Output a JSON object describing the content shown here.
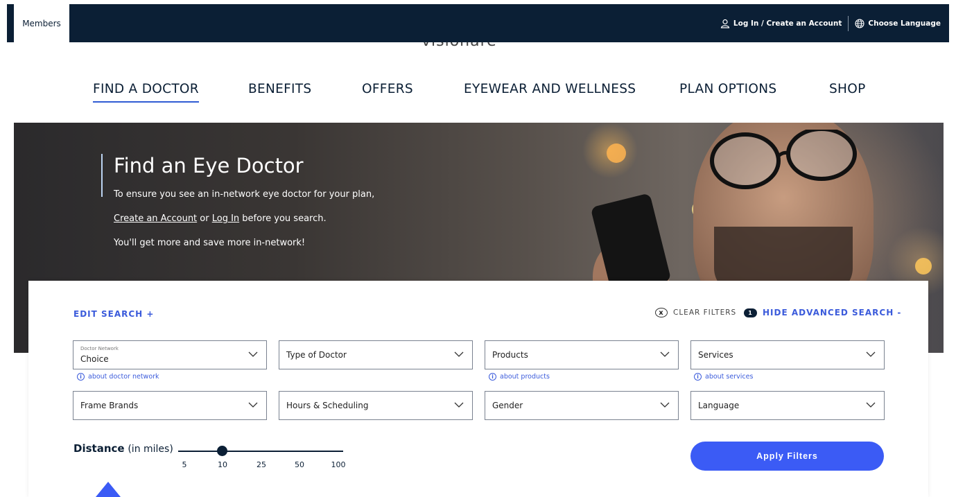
{
  "topbar": {
    "members_label": "Members",
    "login_label": "Log In / Create an Account",
    "language_label": "Choose Language",
    "logo_text": "visionare"
  },
  "nav": {
    "items": [
      "FIND A DOCTOR",
      "BENEFITS",
      "OFFERS",
      "EYEWEAR AND WELLNESS",
      "PLAN OPTIONS",
      "SHOP"
    ],
    "active": "FIND A DOCTOR"
  },
  "hero": {
    "title": "Find an Eye Doctor",
    "line1": "To ensure you see an in-network eye doctor for your plan,",
    "create_link": "Create an Account",
    "or_text": " or ",
    "login_link": "Log In",
    "line2_suffix": " before you search.",
    "line3": "You'll get more and save more in-network!"
  },
  "search": {
    "edit_label": "EDIT SEARCH +",
    "clear_label": "CLEAR FILTERS",
    "clear_icon": "x",
    "advanced_count": "1",
    "advanced_label": "HIDE ADVANCED SEARCH -",
    "doctor_network_label": "Doctor Network",
    "doctor_network_value": "Choice",
    "type_of_doctor": "Type of Doctor",
    "products": "Products",
    "services": "Services",
    "frame_brands": "Frame Brands",
    "hours": "Hours & Scheduling",
    "gender": "Gender",
    "language": "Language",
    "about_network": "about doctor network",
    "about_products": "about products",
    "about_services": "about services",
    "info_glyph": "i",
    "distance_label": "Distance",
    "distance_unit": "(in miles)",
    "distance_ticks": [
      "5",
      "10",
      "25",
      "50",
      "100"
    ],
    "distance_selected": "10",
    "apply_label": "Apply Filters"
  },
  "colors": {
    "navy": "#0b1f35",
    "accent": "#3b5bdb",
    "button": "#3b5bf5"
  }
}
